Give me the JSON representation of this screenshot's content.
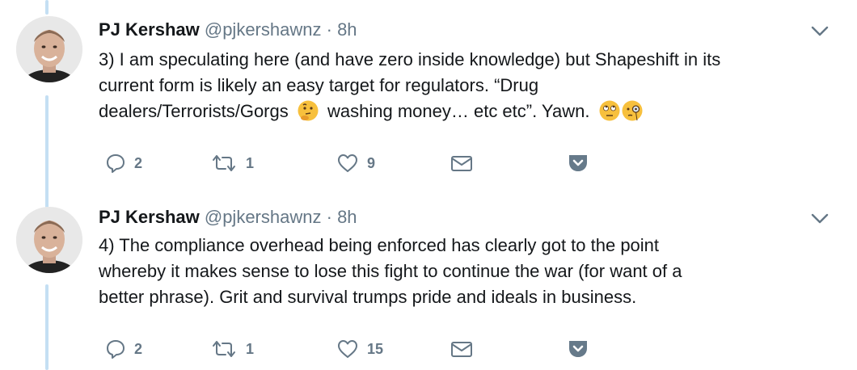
{
  "tweets": [
    {
      "author_name": "PJ Kershaw",
      "handle": "@pjkershawnz",
      "separator": "·",
      "time": "8h",
      "text_part1": "3) I am speculating here (and have zero inside knowledge) but Shapeshift in its\ncurrent form is likely an easy target for regulators. “Drug\ndealers/Terrorists/Gorgs",
      "text_part2": "washing money… etc etc”. Yawn.",
      "emoji_icons": [
        "thinking-face-icon",
        "face-with-rolling-eyes-icon",
        "face-with-monocle-icon"
      ],
      "reply_count": "2",
      "retweet_count": "1",
      "like_count": "9"
    },
    {
      "author_name": "PJ Kershaw",
      "handle": "@pjkershawnz",
      "separator": "·",
      "time": "8h",
      "text": "4) The compliance overhead being enforced has clearly got to the point\nwhereby it makes sense to lose this fight to continue the war (for want of a\nbetter phrase). Grit and survival trumps pride and ideals in business.",
      "reply_count": "2",
      "retweet_count": "1",
      "like_count": "15"
    }
  ],
  "icons": {
    "reply": "reply-icon",
    "retweet": "retweet-icon",
    "like": "heart-icon",
    "dm": "envelope-icon",
    "pocket": "pocket-icon",
    "more": "chevron-down-icon"
  },
  "colors": {
    "thread_line": "#c4dff3",
    "icon_gray": "#657786",
    "text": "#14171a",
    "pocket": "#667a8a"
  }
}
